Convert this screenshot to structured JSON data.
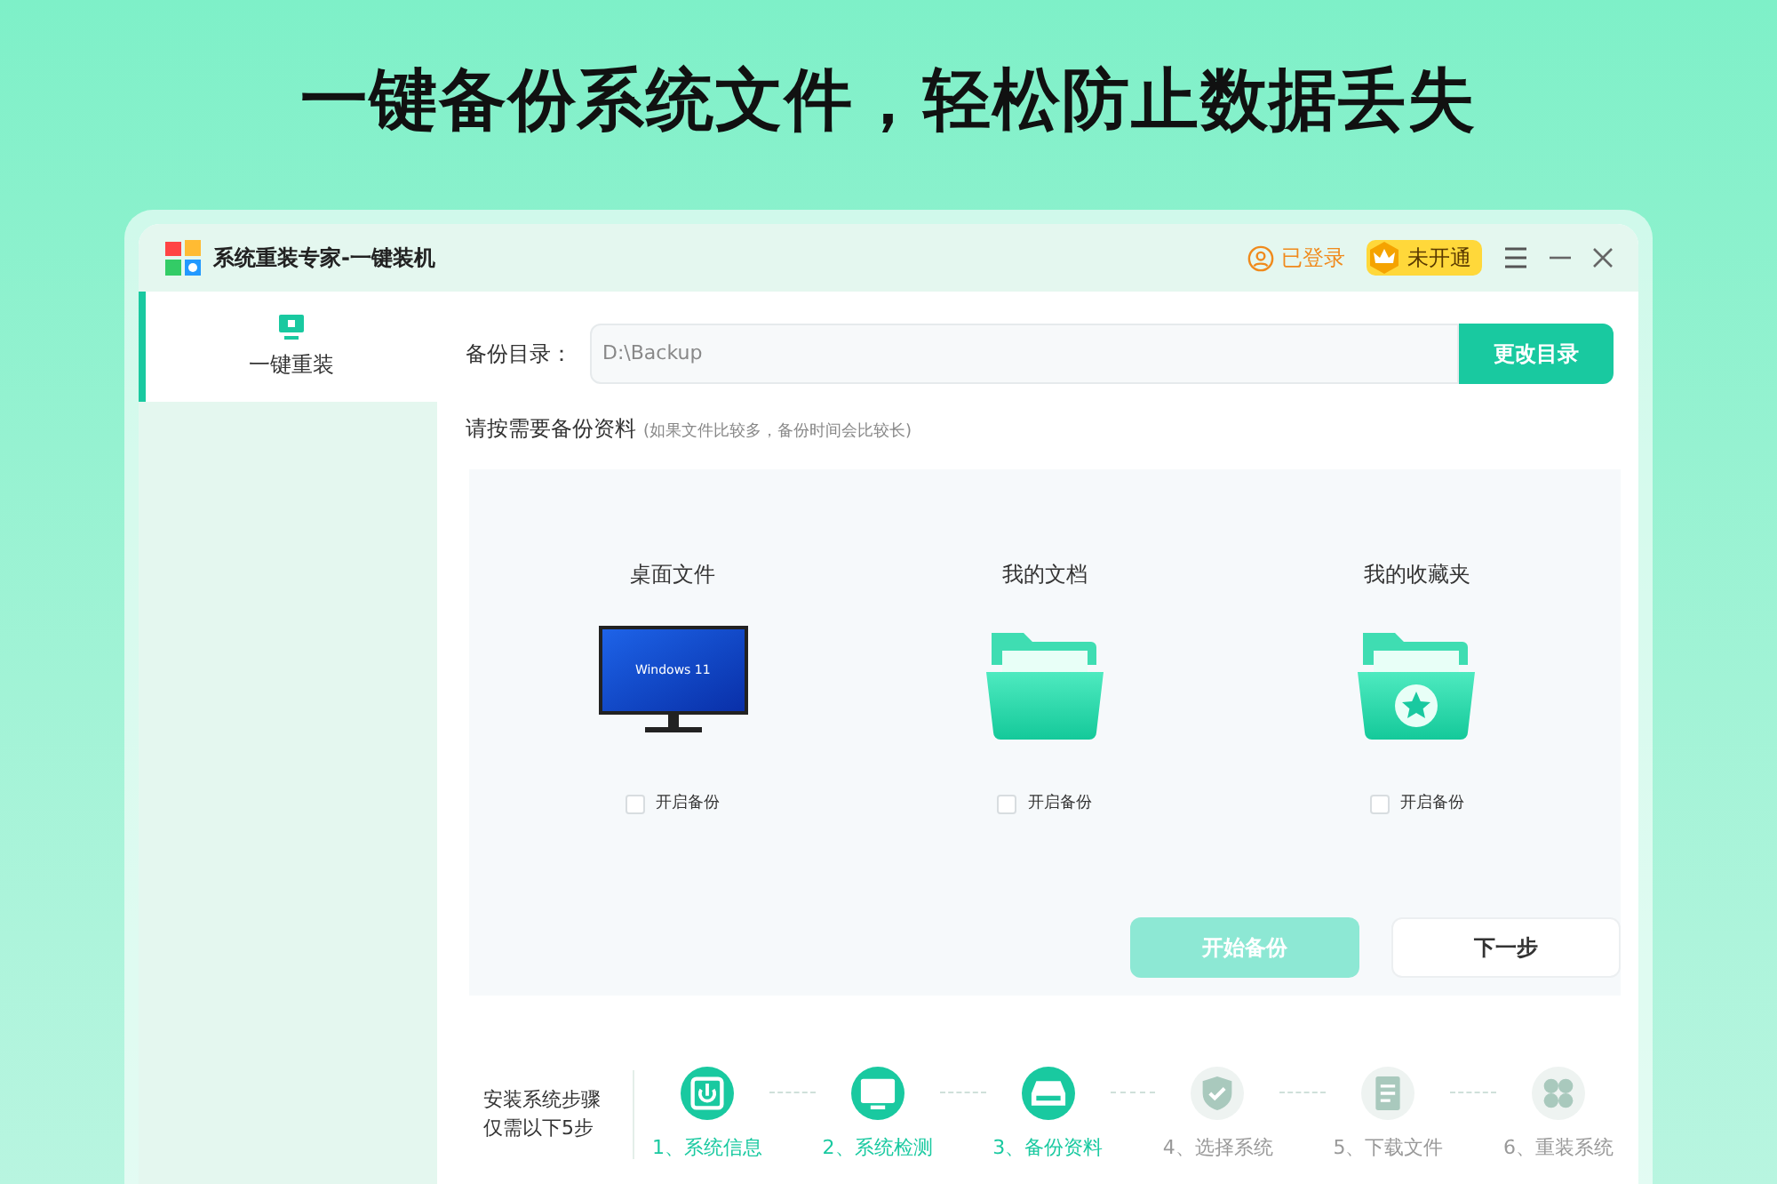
{
  "headline": "一键备份系统文件，轻松防止数据丢失",
  "window": {
    "title": "系统重装专家-一键装机"
  },
  "header": {
    "login": "已登录",
    "vip": "未开通"
  },
  "sidebar": {
    "items": [
      {
        "label": "一键重装",
        "selected": true
      }
    ]
  },
  "backup_dir": {
    "label": "备份目录：",
    "value": "D:\\Backup",
    "button": "更改目录"
  },
  "section": {
    "title": "请按需要备份资料",
    "hint": "(如果文件比较多，备份时间会比较长)"
  },
  "items": [
    {
      "kind": "desktop",
      "title": "桌面文件",
      "screen_text": "Windows 11",
      "checkbox": "开启备份",
      "checked": false
    },
    {
      "kind": "documents",
      "title": "我的文档",
      "checkbox": "开启备份",
      "checked": false
    },
    {
      "kind": "favorites",
      "title": "我的收藏夹",
      "checkbox": "开启备份",
      "checked": false
    }
  ],
  "actions": {
    "start": {
      "label": "开始备份",
      "disabled": true
    },
    "next": "下一步"
  },
  "steps": {
    "label_lines": [
      "安装系统步骤",
      "仅需以下5步"
    ],
    "items": [
      {
        "kind": "info",
        "label": "1、系统信息",
        "done": true
      },
      {
        "kind": "monitor",
        "label": "2、系统检测",
        "done": true
      },
      {
        "kind": "disk",
        "label": "3、备份资料",
        "done": true
      },
      {
        "kind": "shield",
        "label": "4、选择系统",
        "done": false
      },
      {
        "kind": "document",
        "label": "5、下载文件",
        "done": false
      },
      {
        "kind": "grid",
        "label": "6、重装系统",
        "done": false
      }
    ]
  }
}
